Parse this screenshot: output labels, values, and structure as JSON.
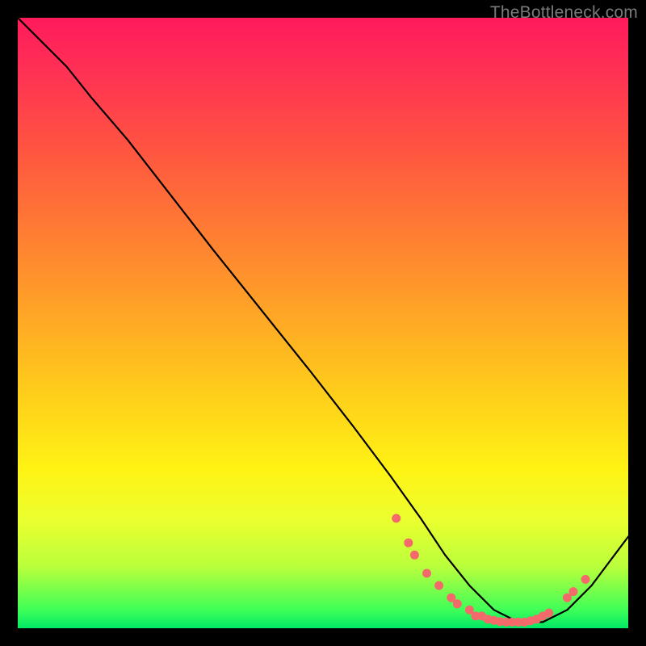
{
  "watermark": {
    "text": "TheBottleneck.com"
  },
  "colors": {
    "curve": "#000000",
    "dot_fill": "#f46a6a",
    "dot_stroke": "#c94a4a"
  },
  "chart_data": {
    "type": "line",
    "title": "",
    "xlabel": "",
    "ylabel": "",
    "xlim": [
      0,
      100
    ],
    "ylim": [
      0,
      100
    ],
    "grid": false,
    "series": [
      {
        "name": "curve",
        "x": [
          0,
          3,
          8,
          12,
          18,
          25,
          32,
          40,
          48,
          55,
          61,
          66,
          70,
          74,
          78,
          82,
          86,
          90,
          94,
          100
        ],
        "y": [
          100,
          97,
          92,
          87,
          80,
          71,
          62,
          52,
          42,
          33,
          25,
          18,
          12,
          7,
          3,
          1,
          1,
          3,
          7,
          15
        ]
      }
    ],
    "marker_points": [
      {
        "x": 62,
        "y": 18
      },
      {
        "x": 64,
        "y": 14
      },
      {
        "x": 65,
        "y": 12
      },
      {
        "x": 67,
        "y": 9
      },
      {
        "x": 69,
        "y": 7
      },
      {
        "x": 71,
        "y": 5
      },
      {
        "x": 72,
        "y": 4
      },
      {
        "x": 74,
        "y": 3
      },
      {
        "x": 75,
        "y": 2
      },
      {
        "x": 76,
        "y": 2
      },
      {
        "x": 77,
        "y": 1.5
      },
      {
        "x": 78,
        "y": 1.3
      },
      {
        "x": 79,
        "y": 1.1
      },
      {
        "x": 80,
        "y": 1
      },
      {
        "x": 81,
        "y": 1
      },
      {
        "x": 82,
        "y": 1
      },
      {
        "x": 83,
        "y": 1
      },
      {
        "x": 84,
        "y": 1.2
      },
      {
        "x": 85,
        "y": 1.5
      },
      {
        "x": 86,
        "y": 2
      },
      {
        "x": 87,
        "y": 2.5
      },
      {
        "x": 90,
        "y": 5
      },
      {
        "x": 91,
        "y": 6
      },
      {
        "x": 93,
        "y": 8
      }
    ]
  }
}
